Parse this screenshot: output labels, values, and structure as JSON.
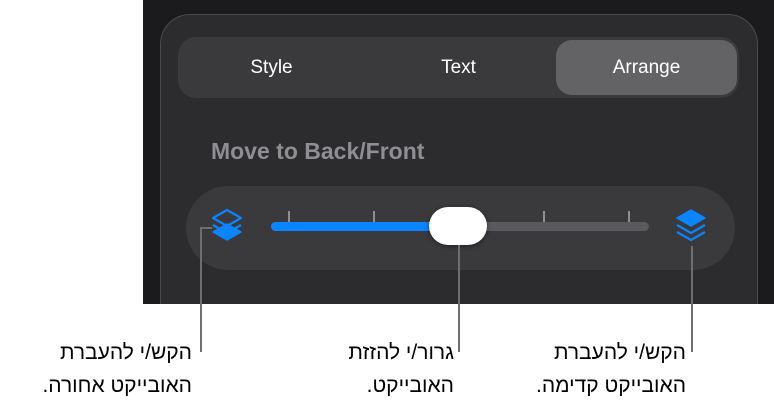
{
  "tabs": [
    {
      "label": "Style",
      "selected": false
    },
    {
      "label": "Text",
      "selected": false
    },
    {
      "label": "Arrange",
      "selected": true
    }
  ],
  "section_title": "Move to Back/Front",
  "slider": {
    "value_fraction": 0.5,
    "tick_count": 5,
    "back_icon": "layers-back-icon",
    "front_icon": "layers-front-icon",
    "accent_color": "#0a84ff"
  },
  "callouts": {
    "back": {
      "line1": "הקש/י להעברת",
      "line2": "האובייקט אחורה."
    },
    "drag": {
      "line1": "גרור/י להזזת",
      "line2": "האובייקט."
    },
    "front": {
      "line1": "הקש/י להעברת",
      "line2": "האובייקט קדימה."
    }
  }
}
